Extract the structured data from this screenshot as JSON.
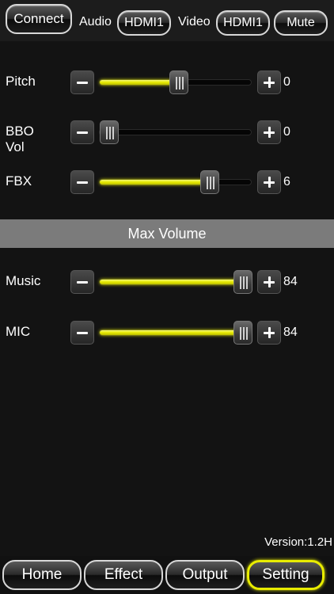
{
  "topbar": {
    "connect_label": "Connect",
    "audio_label": "Audio",
    "audio_value": "HDMI1",
    "video_label": "Video",
    "video_value": "HDMI1",
    "mute_label": "Mute"
  },
  "sliders": [
    {
      "id": "pitch",
      "label": "Pitch",
      "value": "0",
      "fraction": 0.52
    },
    {
      "id": "bbo-vol",
      "label": "BBO Vol",
      "value": "0",
      "fraction": 0.0
    },
    {
      "id": "fbx",
      "label": "FBX",
      "value": "6",
      "fraction": 0.75
    }
  ],
  "max_volume": {
    "title": "Max Volume",
    "sliders": [
      {
        "id": "music",
        "label": "Music",
        "value": "84",
        "fraction": 1.0
      },
      {
        "id": "mic",
        "label": "MIC",
        "value": "84",
        "fraction": 1.0
      }
    ]
  },
  "version": "Version:1.2H",
  "tabs": [
    {
      "label": "Home",
      "active": false
    },
    {
      "label": "Effect",
      "active": false
    },
    {
      "label": "Output",
      "active": false
    },
    {
      "label": "Setting",
      "active": true
    }
  ],
  "colors": {
    "accent": "#e6ea00",
    "background": "#131313",
    "section_bar": "#7b7b7b"
  },
  "icons": {
    "decrease": "minus-icon",
    "increase": "plus-icon",
    "thumb": "slider-grip-icon"
  }
}
